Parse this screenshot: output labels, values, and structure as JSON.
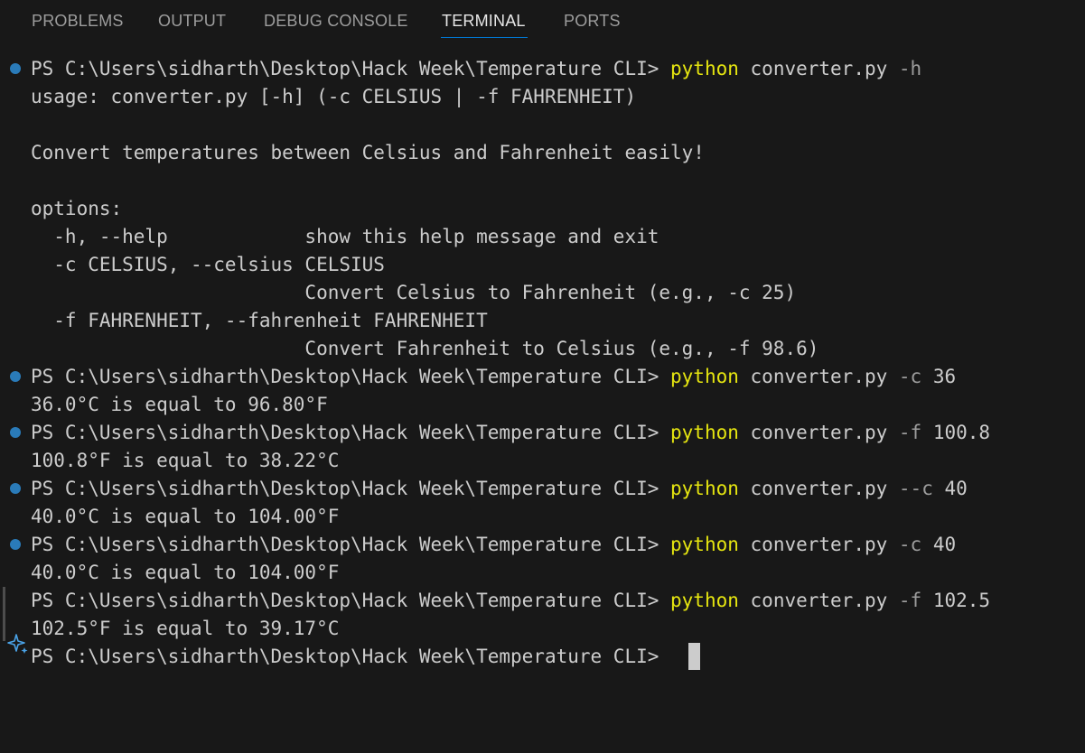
{
  "panel": {
    "tabs": [
      {
        "label": "PROBLEMS",
        "active": false
      },
      {
        "label": "OUTPUT",
        "active": false
      },
      {
        "label": "DEBUG CONSOLE",
        "active": false
      },
      {
        "label": "TERMINAL",
        "active": true
      },
      {
        "label": "PORTS",
        "active": false
      }
    ],
    "accent_color": "#0078d4"
  },
  "terminal": {
    "prompt": "PS C:\\Users\\sidharth\\Desktop\\Hack Week\\Temperature CLI> ",
    "executable": "python",
    "script": "converter.py",
    "commands": [
      {
        "flag": "-h",
        "arg": "",
        "status": "success"
      },
      {
        "flag": "-c",
        "arg": "36",
        "status": "success"
      },
      {
        "flag": "-f",
        "arg": "100.8",
        "status": "success"
      },
      {
        "flag": "--c",
        "arg": "40",
        "status": "success"
      },
      {
        "flag": "-c",
        "arg": "40",
        "status": "success"
      },
      {
        "flag": "-f",
        "arg": "102.5",
        "status": "neutral"
      }
    ],
    "help": {
      "usage": "usage: converter.py [-h] (-c CELSIUS | -f FAHRENHEIT)",
      "description": "Convert temperatures between Celsius and Fahrenheit easily!",
      "options_header": "options:",
      "opt_h": "  -h, --help            show this help message and exit",
      "opt_c": "  -c CELSIUS, --celsius CELSIUS",
      "opt_c_desc": "                        Convert Celsius to Fahrenheit (e.g., -c 25)",
      "opt_f": "  -f FAHRENHEIT, --fahrenheit FAHRENHEIT",
      "opt_f_desc": "                        Convert Fahrenheit to Celsius (e.g., -f 98.6)"
    },
    "results": [
      "36.0°C is equal to 96.80°F",
      "100.8°F is equal to 38.22°C",
      "40.0°C is equal to 104.00°F",
      "40.0°C is equal to 104.00°F",
      "102.5°F is equal to 39.17°C"
    ],
    "colors": {
      "background": "#181818",
      "text": "#cccccc",
      "executable": "#e5e510",
      "flag": "#9d9d9d",
      "success_decoration": "#2a7bb9"
    }
  }
}
